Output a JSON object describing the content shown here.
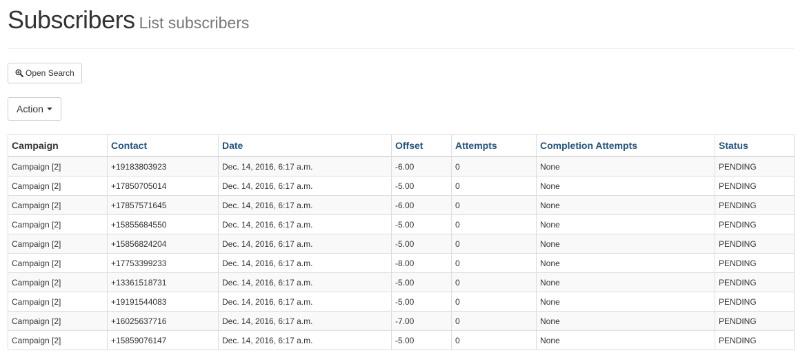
{
  "header": {
    "title": "Subscribers",
    "subtitle": "List subscribers"
  },
  "toolbar": {
    "search_label": "Open Search",
    "search_icon": "zoom-in-icon",
    "action_label": "Action"
  },
  "table": {
    "columns": [
      "Campaign",
      "Contact",
      "Date",
      "Offset",
      "Attempts",
      "Completion Attempts",
      "Status"
    ],
    "rows": [
      [
        "Campaign [2]",
        "+19183803923",
        "Dec. 14, 2016, 6:17 a.m.",
        "-6.00",
        "0",
        "None",
        "PENDING"
      ],
      [
        "Campaign [2]",
        "+17850705014",
        "Dec. 14, 2016, 6:17 a.m.",
        "-5.00",
        "0",
        "None",
        "PENDING"
      ],
      [
        "Campaign [2]",
        "+17857571645",
        "Dec. 14, 2016, 6:17 a.m.",
        "-6.00",
        "0",
        "None",
        "PENDING"
      ],
      [
        "Campaign [2]",
        "+15855684550",
        "Dec. 14, 2016, 6:17 a.m.",
        "-5.00",
        "0",
        "None",
        "PENDING"
      ],
      [
        "Campaign [2]",
        "+15856824204",
        "Dec. 14, 2016, 6:17 a.m.",
        "-5.00",
        "0",
        "None",
        "PENDING"
      ],
      [
        "Campaign [2]",
        "+17753399233",
        "Dec. 14, 2016, 6:17 a.m.",
        "-8.00",
        "0",
        "None",
        "PENDING"
      ],
      [
        "Campaign [2]",
        "+13361518731",
        "Dec. 14, 2016, 6:17 a.m.",
        "-5.00",
        "0",
        "None",
        "PENDING"
      ],
      [
        "Campaign [2]",
        "+19191544083",
        "Dec. 14, 2016, 6:17 a.m.",
        "-5.00",
        "0",
        "None",
        "PENDING"
      ],
      [
        "Campaign [2]",
        "+16025637716",
        "Dec. 14, 2016, 6:17 a.m.",
        "-7.00",
        "0",
        "None",
        "PENDING"
      ],
      [
        "Campaign [2]",
        "+15859076147",
        "Dec. 14, 2016, 6:17 a.m.",
        "-5.00",
        "0",
        "None",
        "PENDING"
      ]
    ]
  },
  "colors": {
    "link": "#23527c",
    "text": "#333333",
    "muted": "#777777",
    "border": "#dddddd",
    "stripe": "#f9f9f9"
  }
}
